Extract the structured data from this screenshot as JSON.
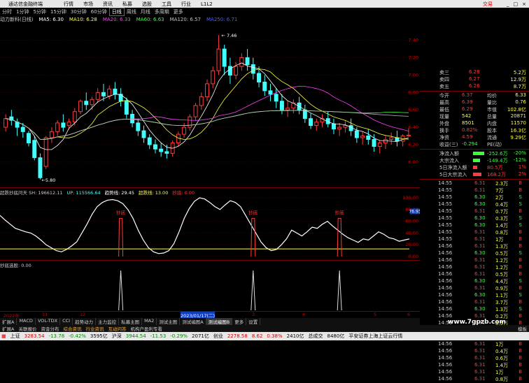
{
  "titlebar": {
    "app": "通达信金融终端",
    "menus": [
      "行情",
      "市场",
      "资讯",
      "私募",
      "选股",
      "工具",
      "行业",
      "L1L2"
    ],
    "broker": "交易",
    "buttons": [
      "_",
      "□",
      "×"
    ]
  },
  "periods": [
    "分时",
    "1分钟",
    "5分钟",
    "15分钟",
    "30分钟",
    "60分钟",
    "日线",
    "周线",
    "月线",
    "多周期",
    "更多"
  ],
  "active_period": "日线",
  "ma_legend": {
    "name": "动力新科(日线)",
    "items": [
      {
        "label": "MA5: 6.30",
        "color": "#ffffff"
      },
      {
        "label": "MA10: 6.28",
        "color": "#ffff40"
      },
      {
        "label": "MA20: 6.33",
        "color": "#ff40ff"
      },
      {
        "label": "MA60: 6.63",
        "color": "#40ff40"
      },
      {
        "label": "MA120: 6.57",
        "color": "#c0c0c0"
      },
      {
        "label": "MA250: 6.71",
        "color": "#4060ff"
      }
    ]
  },
  "price_annotations": {
    "high": "7.46",
    "low": "5.80"
  },
  "axis_price_labels": [
    "7.40",
    "7.20",
    "7.00",
    "6.80",
    "6.60",
    "6.40",
    "6.20",
    "6.00"
  ],
  "orderbook": [
    {
      "label": "卖三",
      "price": "6.28",
      "vol": "5.2万"
    },
    {
      "label": "卖四",
      "price": "6.27",
      "vol": "12.9万"
    },
    {
      "label": "卖五",
      "price": "6.26",
      "vol": "8.7万"
    }
  ],
  "stats": [
    {
      "l1": "今开",
      "v1": "6.37",
      "l2": "均价",
      "v2": "6.33"
    },
    {
      "l1": "最高",
      "v1": "6.39",
      "l2": "量比",
      "v2": "0.76"
    },
    {
      "l1": "最低",
      "v1": "6.29",
      "l2": "市值",
      "v2": "102.8亿"
    },
    {
      "l1": "现量",
      "v1": "542",
      "l2": "总量",
      "v2": "20871"
    },
    {
      "l1": "外盘",
      "v1": "8501",
      "l2": "内盘",
      "v2": "11570"
    },
    {
      "l1": "换手",
      "v1": "0.82%",
      "l2": "股本",
      "v2": "16.3亿"
    },
    {
      "l1": "净资",
      "v1": "4.59",
      "l2": "流通",
      "v2": "9.29亿"
    },
    {
      "l1": "收益(三)",
      "v1": "-0.294",
      "l2": "PE(动)",
      "v2": ""
    }
  ],
  "flows": [
    {
      "label": "净流入额",
      "value": "-252.6万",
      "pct": "-20%",
      "bar": 0.4,
      "color": "#3bff3b"
    },
    {
      "label": "大宗流入",
      "value": "-149.4万",
      "pct": "-12%",
      "bar": 0.25,
      "color": "#3bff3b"
    },
    {
      "label": "5日净流入额",
      "value": "80.5万",
      "pct": "1%",
      "bar": 0.15,
      "color": "#ff3b3b"
    },
    {
      "label": "5日大宗流入",
      "value": "168.2万",
      "pct": "2%",
      "bar": 0.3,
      "color": "#ff3b3b"
    }
  ],
  "ticks": [
    {
      "t": "14:55",
      "p": "6.31",
      "v": "2.3万",
      "s": "B"
    },
    {
      "t": "14:55",
      "p": "6.31",
      "v": "7万",
      "s": "B"
    },
    {
      "t": "14:55",
      "p": "6.30",
      "v": "2万",
      "s": "S"
    },
    {
      "t": "14:55",
      "p": "6.30",
      "v": "0.4万",
      "s": "S"
    },
    {
      "t": "14:55",
      "p": "6.31",
      "v": "0.7万",
      "s": "B"
    },
    {
      "t": "14:55",
      "p": "6.30",
      "v": "0.3万",
      "s": "S"
    },
    {
      "t": "14:55",
      "p": "6.30",
      "v": "1.4万",
      "s": "S"
    },
    {
      "t": "14:55",
      "p": "6.31",
      "v": "0.8万",
      "s": "B"
    },
    {
      "t": "14:55",
      "p": "6.31",
      "v": "1万",
      "s": "B"
    },
    {
      "t": "14:56",
      "p": "6.31",
      "v": "1.3万",
      "s": "B"
    },
    {
      "t": "14:56",
      "p": "6.30",
      "v": "0.5万",
      "s": "S"
    },
    {
      "t": "14:56",
      "p": "6.31",
      "v": "1.2万",
      "s": "B"
    },
    {
      "t": "14:56",
      "p": "6.31",
      "v": "1.2万",
      "s": "B"
    },
    {
      "t": "14:56",
      "p": "6.31",
      "v": "0.5万",
      "s": "B"
    },
    {
      "t": "14:56",
      "p": "6.30",
      "v": "4.4万",
      "s": "S"
    },
    {
      "t": "14:56",
      "p": "6.31",
      "v": "0.9万",
      "s": "B"
    },
    {
      "t": "14:56",
      "p": "6.30",
      "v": "1.1万",
      "s": "S"
    },
    {
      "t": "14:56",
      "p": "6.31",
      "v": "3.7万",
      "s": "B"
    },
    {
      "t": "14:56",
      "p": "6.30",
      "v": "1.3万",
      "s": "S"
    },
    {
      "t": "14:56",
      "p": "6.31",
      "v": "0.2万",
      "s": "B"
    },
    {
      "t": "14:56",
      "p": "6.31",
      "v": "0.5万",
      "s": "B"
    },
    {
      "t": "14:56",
      "p": "6.31",
      "v": "1.7万",
      "s": "B"
    },
    {
      "t": "14:56",
      "p": "6.31",
      "v": "1.2万",
      "s": "B"
    },
    {
      "t": "14:56",
      "p": "6.31",
      "v": "1万",
      "s": "B"
    },
    {
      "t": "14:56",
      "p": "6.31",
      "v": "0.4万",
      "s": "B"
    },
    {
      "t": "14:56",
      "p": "6.31",
      "v": "0.6万",
      "s": "B"
    },
    {
      "t": "14:56",
      "p": "6.31",
      "v": "1.4万",
      "s": "B"
    },
    {
      "t": "14:56",
      "p": "6.31",
      "v": "1万",
      "s": "B"
    },
    {
      "t": "14:56",
      "p": "6.31",
      "v": "0.8万",
      "s": "B"
    }
  ],
  "indicator1": {
    "legend": [
      {
        "text": "超跌抄底问天 SH: 196612.11",
        "color": "#cccccc"
      },
      {
        "text": "UP: 115566.64",
        "color": "#40ffff"
      },
      {
        "text": "趋势线: 29.45",
        "color": "#ffffff"
      },
      {
        "text": "超跌线: 13.00",
        "color": "#ffff40"
      },
      {
        "text": "抄底: 0.00",
        "color": "#ff3b3b"
      }
    ],
    "signal_label": "抄底",
    "current_value": "76.93",
    "axis_labels": [
      "100.00",
      "80.00",
      "60.00",
      "40.00",
      "20.00",
      "0.00"
    ]
  },
  "indicator2": {
    "legend": "抄底选股: 0.00"
  },
  "xaxis": {
    "labels": [
      "2022年",
      "11",
      "12",
      "2023/01/17(二)",
      "3",
      "4",
      "5",
      "6"
    ]
  },
  "tabs": [
    "扩展A",
    "MACD",
    "VOL-TDX",
    "CCI",
    "趋势动力",
    "主力监控",
    "私募主图",
    "MA2",
    "测试主图",
    "测试编图A",
    "测试编图B",
    "更多",
    "设置"
  ],
  "active_tab": "测试编图B",
  "bottomtabs": [
    "扩展A",
    "关联报价",
    "资金分布",
    "综合资讯",
    "行业资讯",
    "互动问答",
    "机构户盈利专看"
  ],
  "bottom_right": "模板",
  "status": {
    "sh_label": "上证",
    "sh_val": "3283.54",
    "sh_chg": "-13.78",
    "sh_pct": "-0.42%",
    "sh_amt": "3595亿",
    "hs_label": "沪深",
    "hs_val": "3944.54",
    "hs_chg": "-11.53",
    "hs_pct": "-0.29%",
    "hs_amt": "2071亿",
    "cy_label": "创业",
    "cy_val": "2278.58",
    "cy_chg": "8.62",
    "cy_pct": "0.38%",
    "cy_amt": "2410亿",
    "total_label": "总成交",
    "total_val": "8480亿",
    "note": "平安证券上海上证云行情"
  },
  "watermark": "www.7gpzb.com",
  "chart_data": {
    "type": "candlestick",
    "price_range": [
      5.8,
      7.46
    ],
    "candles": [
      [
        6.4,
        6.55,
        6.5,
        6.35
      ],
      [
        6.52,
        6.6,
        6.48,
        6.42
      ],
      [
        6.46,
        6.5,
        6.4,
        6.3
      ],
      [
        6.4,
        6.45,
        6.35,
        6.28
      ],
      [
        6.33,
        6.36,
        6.22,
        6.18
      ],
      [
        6.25,
        6.3,
        6.05,
        6.02
      ],
      [
        6.05,
        6.1,
        5.82,
        5.8
      ],
      [
        5.95,
        6.3,
        6.28,
        5.92
      ],
      [
        6.28,
        6.4,
        6.35,
        6.22
      ],
      [
        6.35,
        6.48,
        6.45,
        6.3
      ],
      [
        6.45,
        6.55,
        6.4,
        6.35
      ],
      [
        6.42,
        6.5,
        6.46,
        6.38
      ],
      [
        6.46,
        6.62,
        6.58,
        6.42
      ],
      [
        6.58,
        6.72,
        6.7,
        6.55
      ],
      [
        6.7,
        6.8,
        6.66,
        6.6
      ],
      [
        6.66,
        6.75,
        6.72,
        6.6
      ],
      [
        6.72,
        6.85,
        6.8,
        6.68
      ],
      [
        6.8,
        6.9,
        6.76,
        6.7
      ],
      [
        6.76,
        6.88,
        6.84,
        6.72
      ],
      [
        6.84,
        6.92,
        6.78,
        6.72
      ],
      [
        6.78,
        6.85,
        6.7,
        6.64
      ],
      [
        6.7,
        6.74,
        6.55,
        6.5
      ],
      [
        6.55,
        6.6,
        6.45,
        6.4
      ],
      [
        6.45,
        6.5,
        6.36,
        6.3
      ],
      [
        6.36,
        6.42,
        6.28,
        6.22
      ],
      [
        6.28,
        6.32,
        6.2,
        6.15
      ],
      [
        6.2,
        6.26,
        6.15,
        6.1
      ],
      [
        6.15,
        6.22,
        6.12,
        6.06
      ],
      [
        6.12,
        6.2,
        6.1,
        6.04
      ],
      [
        6.1,
        6.25,
        6.22,
        6.06
      ],
      [
        6.22,
        6.35,
        6.32,
        6.18
      ],
      [
        6.32,
        6.45,
        6.4,
        6.28
      ],
      [
        6.4,
        6.55,
        6.52,
        6.36
      ],
      [
        6.52,
        6.68,
        6.65,
        6.48
      ],
      [
        6.65,
        6.8,
        6.75,
        6.6
      ],
      [
        6.75,
        6.95,
        6.9,
        6.7
      ],
      [
        6.9,
        7.1,
        7.05,
        6.85
      ],
      [
        7.05,
        7.46,
        7.3,
        7.0
      ],
      [
        7.3,
        7.35,
        7.1,
        7.0
      ],
      [
        7.1,
        7.2,
        7.0,
        6.9
      ],
      [
        7.0,
        7.15,
        7.1,
        6.95
      ],
      [
        7.1,
        7.25,
        7.2,
        7.05
      ],
      [
        7.2,
        7.3,
        7.12,
        7.05
      ],
      [
        7.12,
        7.2,
        7.02,
        6.95
      ],
      [
        7.02,
        7.1,
        6.92,
        6.86
      ],
      [
        6.92,
        7.0,
        6.82,
        6.76
      ],
      [
        6.82,
        6.9,
        6.78,
        6.7
      ],
      [
        6.78,
        6.85,
        6.7,
        6.62
      ],
      [
        6.7,
        6.78,
        6.6,
        6.55
      ],
      [
        6.6,
        6.7,
        6.62,
        6.52
      ],
      [
        6.62,
        6.72,
        6.68,
        6.56
      ],
      [
        6.68,
        6.75,
        6.6,
        6.55
      ],
      [
        6.6,
        6.66,
        6.5,
        6.45
      ],
      [
        6.5,
        6.56,
        6.42,
        6.38
      ],
      [
        6.42,
        6.5,
        6.46,
        6.36
      ],
      [
        6.46,
        6.55,
        6.5,
        6.4
      ],
      [
        6.5,
        6.58,
        6.44,
        6.4
      ],
      [
        6.44,
        6.5,
        6.38,
        6.32
      ],
      [
        6.38,
        6.45,
        6.4,
        6.3
      ],
      [
        6.4,
        6.48,
        6.42,
        6.34
      ],
      [
        6.42,
        6.5,
        6.36,
        6.3
      ],
      [
        6.36,
        6.4,
        6.28,
        6.22
      ],
      [
        6.28,
        6.35,
        6.3,
        6.2
      ],
      [
        6.3,
        6.38,
        6.26,
        6.2
      ],
      [
        6.26,
        6.32,
        6.18,
        6.12
      ],
      [
        6.18,
        6.25,
        6.22,
        6.1
      ],
      [
        6.22,
        6.3,
        6.26,
        6.15
      ],
      [
        6.26,
        6.34,
        6.28,
        6.2
      ],
      [
        6.28,
        6.36,
        6.24,
        6.18
      ],
      [
        6.24,
        6.32,
        6.3,
        6.18
      ],
      [
        6.3,
        6.39,
        6.31,
        6.29
      ]
    ],
    "indicator_trend": [
      70,
      62,
      55,
      48,
      45,
      42,
      40,
      35,
      28,
      20,
      15,
      10,
      8,
      12,
      18,
      25,
      40,
      55,
      72,
      85,
      92,
      96,
      97,
      95,
      90,
      80,
      65,
      45,
      28,
      15,
      8,
      5,
      6,
      10,
      22,
      42,
      65,
      82,
      94,
      100,
      98,
      92,
      85,
      80,
      88,
      95,
      92,
      85,
      70,
      55,
      40,
      25,
      15,
      10,
      12,
      20,
      30,
      45,
      40,
      35,
      42,
      50,
      48,
      55,
      60,
      52,
      45,
      38,
      32,
      28,
      24,
      30,
      28,
      35,
      42,
      38,
      32,
      30,
      26,
      28,
      30
    ],
    "signal_indices": [
      20,
      43,
      58
    ],
    "indicator2_spikes": [
      20,
      43,
      58
    ]
  }
}
